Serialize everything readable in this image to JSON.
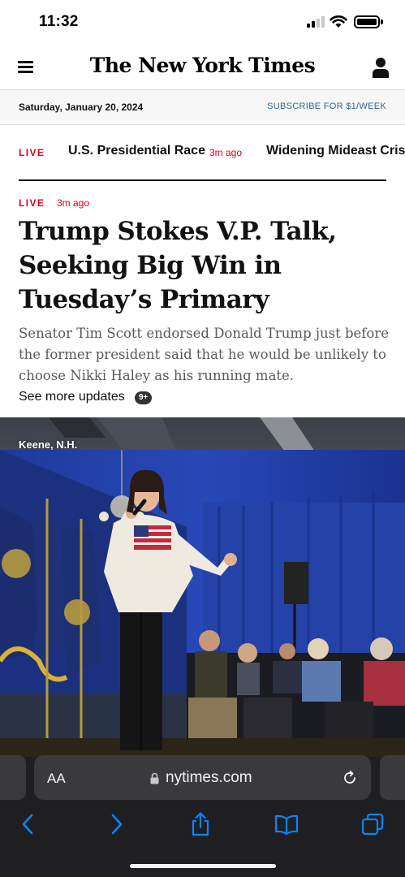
{
  "status_bar": {
    "time": "11:32"
  },
  "masthead": {
    "logo": "The New York Times"
  },
  "date_bar": {
    "date": "Saturday, January 20, 2024",
    "subscribe": "SUBSCRIBE FOR $1/WEEK"
  },
  "ticker": {
    "live_label": "LIVE",
    "items": [
      {
        "label": "U.S. Presidential Race",
        "time": "3m ago"
      },
      {
        "label": "Widening Mideast Crisis"
      }
    ]
  },
  "story": {
    "live_label": "LIVE",
    "time": "3m ago",
    "headline": "Trump Stokes V.P. Talk, Seeking Big Win in Tuesday’s Primary",
    "summary": "Senator Tim Scott endorsed Donald Trump just before the former president said that he would be unlikely to choose Nikki Haley as his running mate.",
    "more_updates": "See more updates",
    "more_count": "9+"
  },
  "photo": {
    "dateline": "Keene, N.H."
  },
  "browser": {
    "aa_label": "AA",
    "url": "nytimes.com"
  },
  "icons": {
    "menu": "hamburger-menu-icon",
    "account": "user-icon",
    "lock": "lock-icon",
    "reload": "reload-icon",
    "back": "back-icon",
    "forward": "forward-icon",
    "share": "share-icon",
    "bookmarks": "bookmarks-icon",
    "tabs": "tabs-icon"
  },
  "colors": {
    "live_red": "#d0021b",
    "link_blue": "#326891",
    "ios_blue": "#0a84ff"
  }
}
